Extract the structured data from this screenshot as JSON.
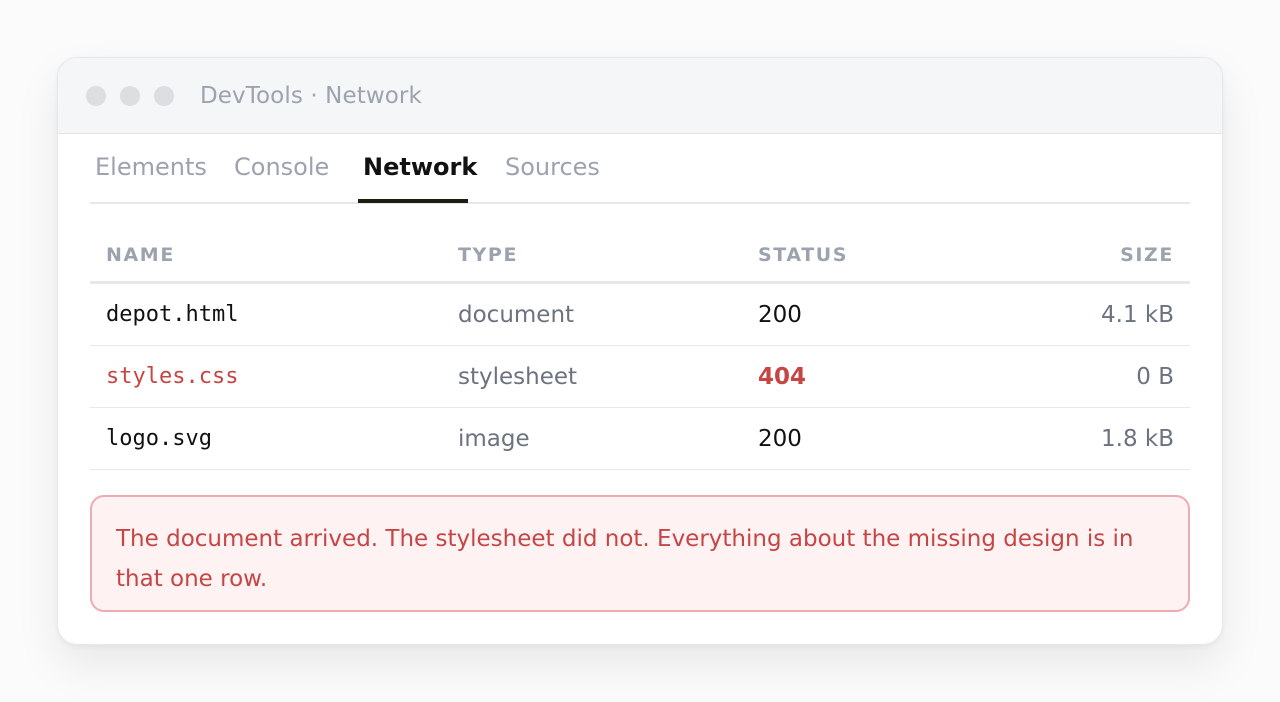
{
  "window": {
    "title": "DevTools · Network"
  },
  "tabs": [
    {
      "label": "Elements",
      "active": false
    },
    {
      "label": "Console",
      "active": false
    },
    {
      "label": "Network",
      "active": true
    },
    {
      "label": "Sources",
      "active": false
    }
  ],
  "table": {
    "columns": {
      "name": "NAME",
      "type": "TYPE",
      "status": "STATUS",
      "size": "SIZE"
    },
    "rows": [
      {
        "name": "depot.html",
        "type": "document",
        "status": "200",
        "size": "4.1 kB",
        "error": false
      },
      {
        "name": "styles.css",
        "type": "stylesheet",
        "status": "404",
        "size": "0 B",
        "error": true
      },
      {
        "name": "logo.svg",
        "type": "image",
        "status": "200",
        "size": "1.8 kB",
        "error": false
      }
    ]
  },
  "alert": {
    "text": "The document arrived. The stylesheet did not. Everything about the missing design is in that one row."
  },
  "colors": {
    "error": "#c64545",
    "alert_bg": "#fef2f3",
    "alert_border": "#efabb0",
    "tab_underline": "#1c1e10"
  }
}
